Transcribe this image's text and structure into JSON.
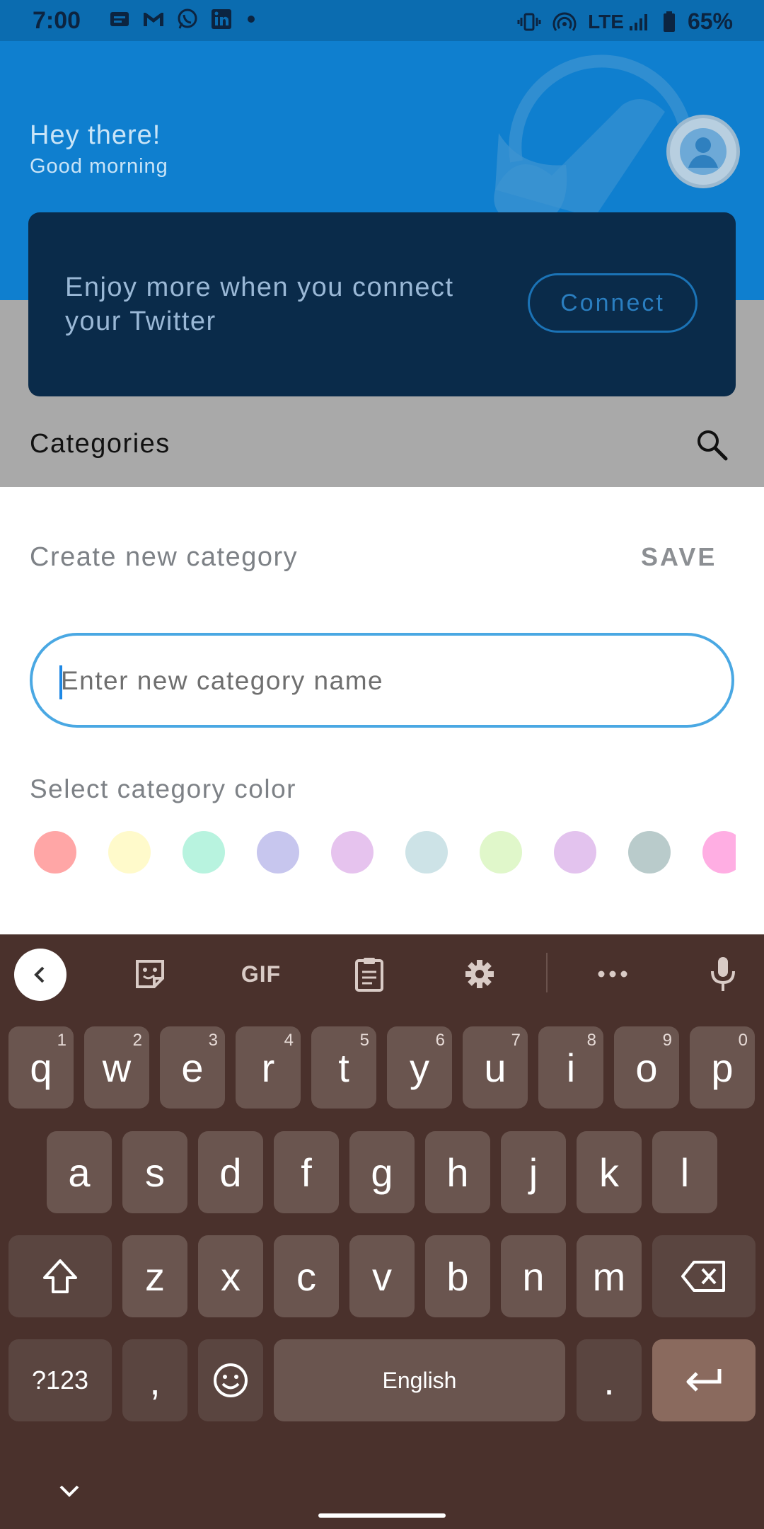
{
  "status_bar": {
    "time": "7:00",
    "network": "LTE",
    "battery": "65%"
  },
  "header": {
    "greeting": "Hey there!",
    "subgreeting": "Good morning"
  },
  "connect_card": {
    "message": "Enjoy more when you connect your Twitter",
    "button_label": "Connect"
  },
  "categories": {
    "title": "Categories"
  },
  "sheet": {
    "title": "Create new category",
    "save_label": "SAVE",
    "input_placeholder": "Enter new category name",
    "color_label": "Select category color",
    "colors": [
      "#ffa6a6",
      "#fffacb",
      "#b8f3df",
      "#c7c6ee",
      "#e6c3ee",
      "#cde3e7",
      "#e0f7ca",
      "#e3c3ee",
      "#b9cbcb",
      "#ffaee3"
    ]
  },
  "keyboard": {
    "row1": [
      {
        "key": "q",
        "hint": "1"
      },
      {
        "key": "w",
        "hint": "2"
      },
      {
        "key": "e",
        "hint": "3"
      },
      {
        "key": "r",
        "hint": "4"
      },
      {
        "key": "t",
        "hint": "5"
      },
      {
        "key": "y",
        "hint": "6"
      },
      {
        "key": "u",
        "hint": "7"
      },
      {
        "key": "i",
        "hint": "8"
      },
      {
        "key": "o",
        "hint": "9"
      },
      {
        "key": "p",
        "hint": "0"
      }
    ],
    "row2": [
      "a",
      "s",
      "d",
      "f",
      "g",
      "h",
      "j",
      "k",
      "l"
    ],
    "row3": [
      "z",
      "x",
      "c",
      "v",
      "b",
      "n",
      "m"
    ],
    "symbols_label": "?123",
    "comma": ",",
    "period": ".",
    "space_label": "English"
  }
}
